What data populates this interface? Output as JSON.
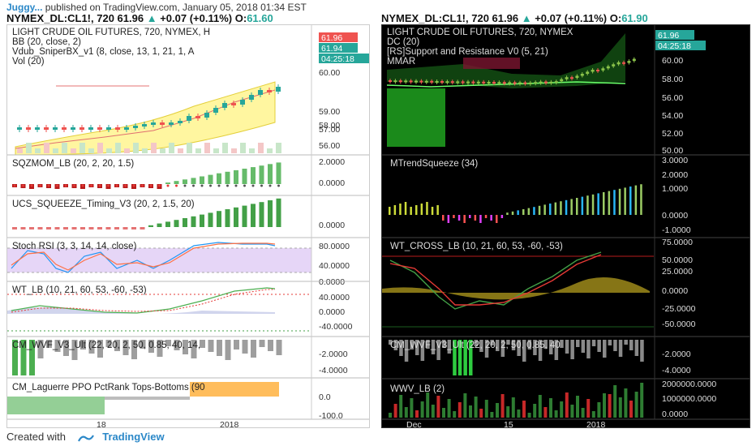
{
  "header": {
    "author": "Juggy...",
    "published": "published on TradingView.com, January 05, 2018 01:34 EST"
  },
  "left": {
    "symbol": "NYMEX_DL:CL1!, 720",
    "last": "61.96",
    "change": "+0.07 (+0.11%)",
    "open_label": "O:",
    "open_value": "61.60",
    "title": "LIGHT CRUDE OIL FUTURES, 720, NYMEX, H",
    "indicators": [
      "BB (20, close, 2)",
      "Vdub_SniperBX_v1 (8, close, 13, 1, 21, 1, A",
      "Vol (20)"
    ],
    "price_tags": [
      "61.96",
      "61.94",
      "04:25:18"
    ],
    "price_axis": [
      "60.00",
      "59.00",
      "58.00",
      "57.00",
      "56.00"
    ],
    "panes": [
      {
        "label": "SQZMOM_LB (20, 2, 20, 1.5)",
        "axis": [
          "2.0000",
          "0.0000"
        ]
      },
      {
        "label": "UCS_SQUEEZE_Timing_V3 (20, 2, 1.5, 20)",
        "axis": [
          "0.0000"
        ]
      },
      {
        "label": "Stoch RSI (3, 3, 14, 14, close)",
        "axis": [
          "80.0000",
          "40.0000",
          "0.0000"
        ]
      },
      {
        "label": "WT_LB (10, 21, 60, 53, -60, -53)",
        "axis": [
          "40.0000",
          "0.0000",
          "-40.0000"
        ]
      },
      {
        "label": "CM_WVF_V3_Ult (22, 20, 2, 50, 0.85, 40, 14,",
        "axis": [
          "-2.0000",
          "-4.0000"
        ]
      },
      {
        "label": "CM_Laguerre PPO PctRank Tops-Bottoms (90",
        "axis": [
          "0.0",
          "-100.0"
        ]
      }
    ],
    "time_axis": [
      "18",
      "2018"
    ]
  },
  "right": {
    "symbol": "NYMEX_DL:CL1!, 720",
    "last": "61.96",
    "change": "+0.07 (+0.11%)",
    "open_label": "O:",
    "open_value": "61.90",
    "title": "LIGHT CRUDE OIL FUTURES, 720, NYMEX",
    "indicators": [
      "DC (20)",
      "[RS]Support and Resistance V0 (5, 21)",
      "MMAR"
    ],
    "price_tags": [
      "61.96",
      "04:25:18"
    ],
    "price_axis": [
      "60.00",
      "58.00",
      "56.00",
      "54.00",
      "52.00",
      "50.00"
    ],
    "panes": [
      {
        "label": "MTrendSqueeze (34)",
        "axis": [
          "3.0000",
          "2.0000",
          "1.0000",
          "0.0000",
          "-1.0000"
        ]
      },
      {
        "label": "WT_CROSS_LB (10, 21, 60, 53, -60, -53)",
        "axis": [
          "75.0000",
          "50.0000",
          "25.0000",
          "0.0000",
          "-25.0000",
          "-50.0000"
        ]
      },
      {
        "label": "CM_WVF_V3_Ult (22, 20, 2, 50, 0.85, 40",
        "axis": [
          "-2.0000",
          "-4.0000"
        ]
      },
      {
        "label": "WWV_LB (2)",
        "axis": [
          "2000000.0000",
          "1000000.0000",
          "0.0000"
        ]
      }
    ],
    "time_axis": [
      "Dec",
      "15",
      "2018"
    ]
  },
  "footer": {
    "created_with": "Created with",
    "brand": "TradingView"
  },
  "colors": {
    "up": "#26a69a",
    "down": "#ef5350",
    "brand": "#2b88c8",
    "bb_fill": "#fff6a0",
    "squeeze_green": "#4caf50",
    "stoch_band": "#e6d6f7"
  }
}
